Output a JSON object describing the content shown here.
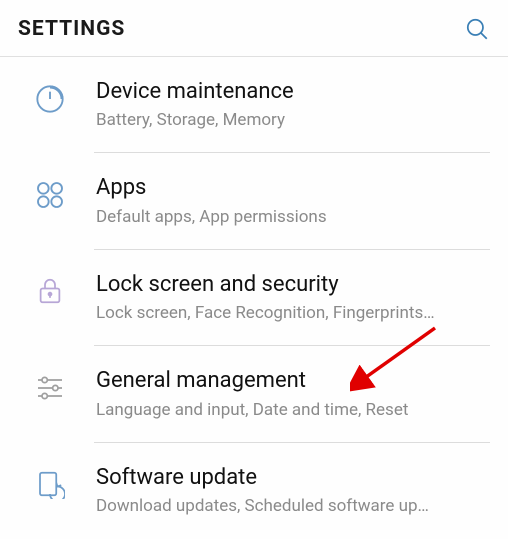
{
  "header": {
    "title": "SETTINGS"
  },
  "items": [
    {
      "title": "Device maintenance",
      "subtitle": "Battery, Storage, Memory"
    },
    {
      "title": "Apps",
      "subtitle": "Default apps, App permissions"
    },
    {
      "title": "Lock screen and security",
      "subtitle": "Lock screen, Face Recognition, Fingerprints…"
    },
    {
      "title": "General management",
      "subtitle": "Language and input, Date and time, Reset"
    },
    {
      "title": "Software update",
      "subtitle": "Download updates, Scheduled software up…"
    }
  ]
}
